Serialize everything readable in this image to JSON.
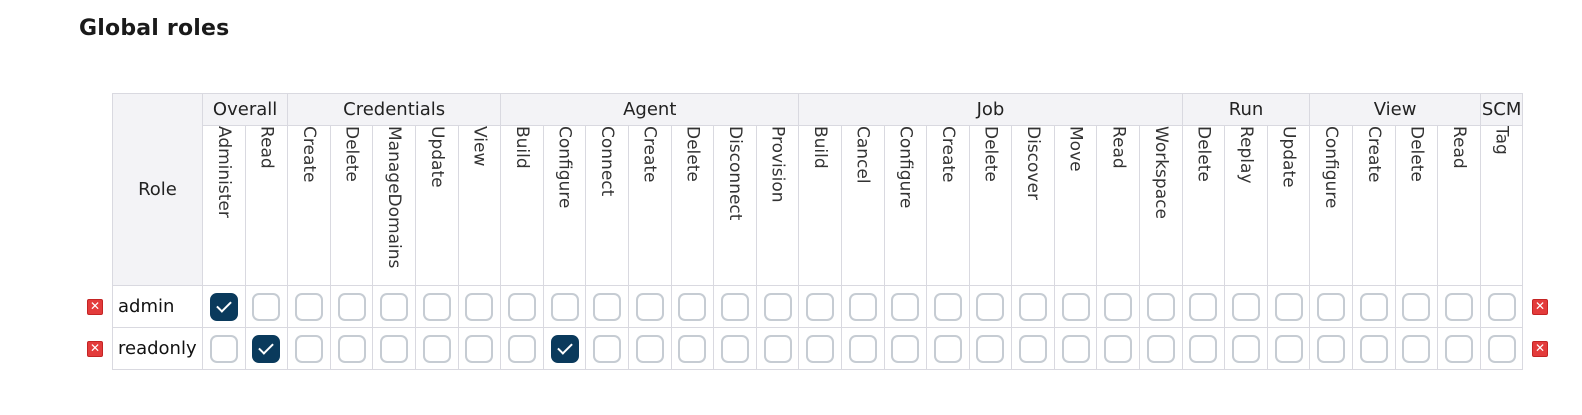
{
  "section_title": "Global roles",
  "role_header": "Role",
  "delete_icon_glyph": "✕",
  "groups": [
    {
      "name": "Overall",
      "permissions": [
        "Administer",
        "Read"
      ]
    },
    {
      "name": "Credentials",
      "permissions": [
        "Create",
        "Delete",
        "ManageDomains",
        "Update",
        "View"
      ]
    },
    {
      "name": "Agent",
      "permissions": [
        "Build",
        "Configure",
        "Connect",
        "Create",
        "Delete",
        "Disconnect",
        "Provision"
      ]
    },
    {
      "name": "Job",
      "permissions": [
        "Build",
        "Cancel",
        "Configure",
        "Create",
        "Delete",
        "Discover",
        "Move",
        "Read",
        "Workspace"
      ]
    },
    {
      "name": "Run",
      "permissions": [
        "Delete",
        "Replay",
        "Update"
      ]
    },
    {
      "name": "View",
      "permissions": [
        "Configure",
        "Create",
        "Delete",
        "Read"
      ]
    },
    {
      "name": "SCM",
      "permissions": [
        "Tag"
      ]
    }
  ],
  "roles": [
    {
      "name": "admin",
      "checked": [
        "Overall/Administer"
      ]
    },
    {
      "name": "readonly",
      "checked": [
        "Overall/Read",
        "Agent/Configure"
      ]
    }
  ],
  "colors": {
    "checked": "#0a3a5c",
    "delete_icon": "#e33b3b"
  }
}
